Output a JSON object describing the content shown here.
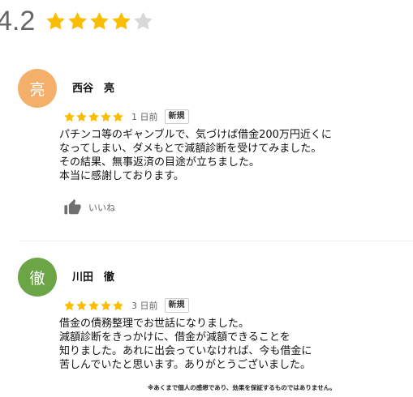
{
  "summary": {
    "rating": "4.2",
    "stars": 4.2,
    "star_color": "#fbbc04",
    "empty_star_color": "#d8d8d8"
  },
  "reviews": [
    {
      "avatar_char": "亮",
      "avatar_color": "#f4b06a",
      "name": "西谷　亮",
      "stars": 5,
      "date": "1 日前",
      "badge": "新規",
      "lines": [
        "パチンコ等のギャンブルで、気づけば借金200万円近くに",
        "なってしまい、ダメもとで減額診断を受けてみました。",
        "その結果、無事返済の目途が立ちました。",
        "本当に感謝しております。"
      ],
      "like_label": "いいね",
      "like_icon": "thumbs-up-icon"
    },
    {
      "avatar_char": "徹",
      "avatar_color": "#6ba546",
      "name": "川田　徹",
      "stars": 5,
      "date": "3 日前",
      "badge": "新規",
      "lines": [
        "借金の債務整理でお世話になりました。",
        "減額診断をきっかけに、借金が減額できることを",
        "知りました。あれに出会っていなければ、今も借金に",
        "苦しんでいたと思います。ありがとうございました。"
      ]
    }
  ],
  "disclaimer": "※あくまで個人の感想であり、効果を保証するものではありません。"
}
